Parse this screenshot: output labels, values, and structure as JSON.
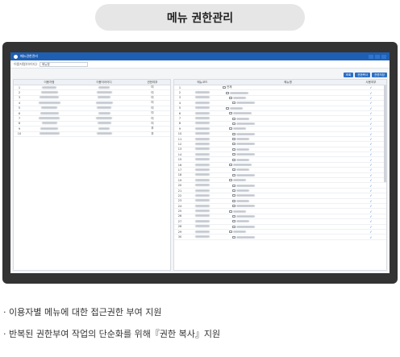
{
  "header": {
    "title": "메뉴 권한관리"
  },
  "app": {
    "window_title": "메뉴권한관리",
    "filter_label": "이용자명(아이디)",
    "filter_value": "메뉴명",
    "buttons": [
      "조회",
      "권한복사",
      "권한저장"
    ]
  },
  "left_table": {
    "headers": [
      "",
      "이용자명",
      "이용자아이디",
      "권한여부"
    ],
    "rows": [
      {
        "no": "1",
        "mark": "미"
      },
      {
        "no": "2",
        "mark": "미"
      },
      {
        "no": "3",
        "mark": "미"
      },
      {
        "no": "4",
        "mark": "미"
      },
      {
        "no": "5",
        "mark": "미"
      },
      {
        "no": "6",
        "mark": "미"
      },
      {
        "no": "7",
        "mark": "미"
      },
      {
        "no": "8",
        "mark": "미"
      },
      {
        "no": "9",
        "mark": "부"
      },
      {
        "no": "10",
        "mark": "부"
      }
    ]
  },
  "right_table": {
    "headers": [
      "",
      "메뉴코드",
      "메뉴명",
      "사용여부"
    ],
    "root_label": "전체",
    "rows": [
      "1",
      "2",
      "3",
      "4",
      "5",
      "6",
      "7",
      "8",
      "9",
      "10",
      "11",
      "12",
      "13",
      "14",
      "15",
      "16",
      "17",
      "18",
      "19",
      "20",
      "21",
      "22",
      "23",
      "24",
      "25",
      "26",
      "27",
      "28",
      "29",
      "30"
    ],
    "check_glyph": "✓"
  },
  "bullets": [
    "· 이용자별 메뉴에 대한 접근권한 부여 지원",
    "· 반복된 권한부여 작업의 단순화를 위해『권한 복사』지원"
  ]
}
